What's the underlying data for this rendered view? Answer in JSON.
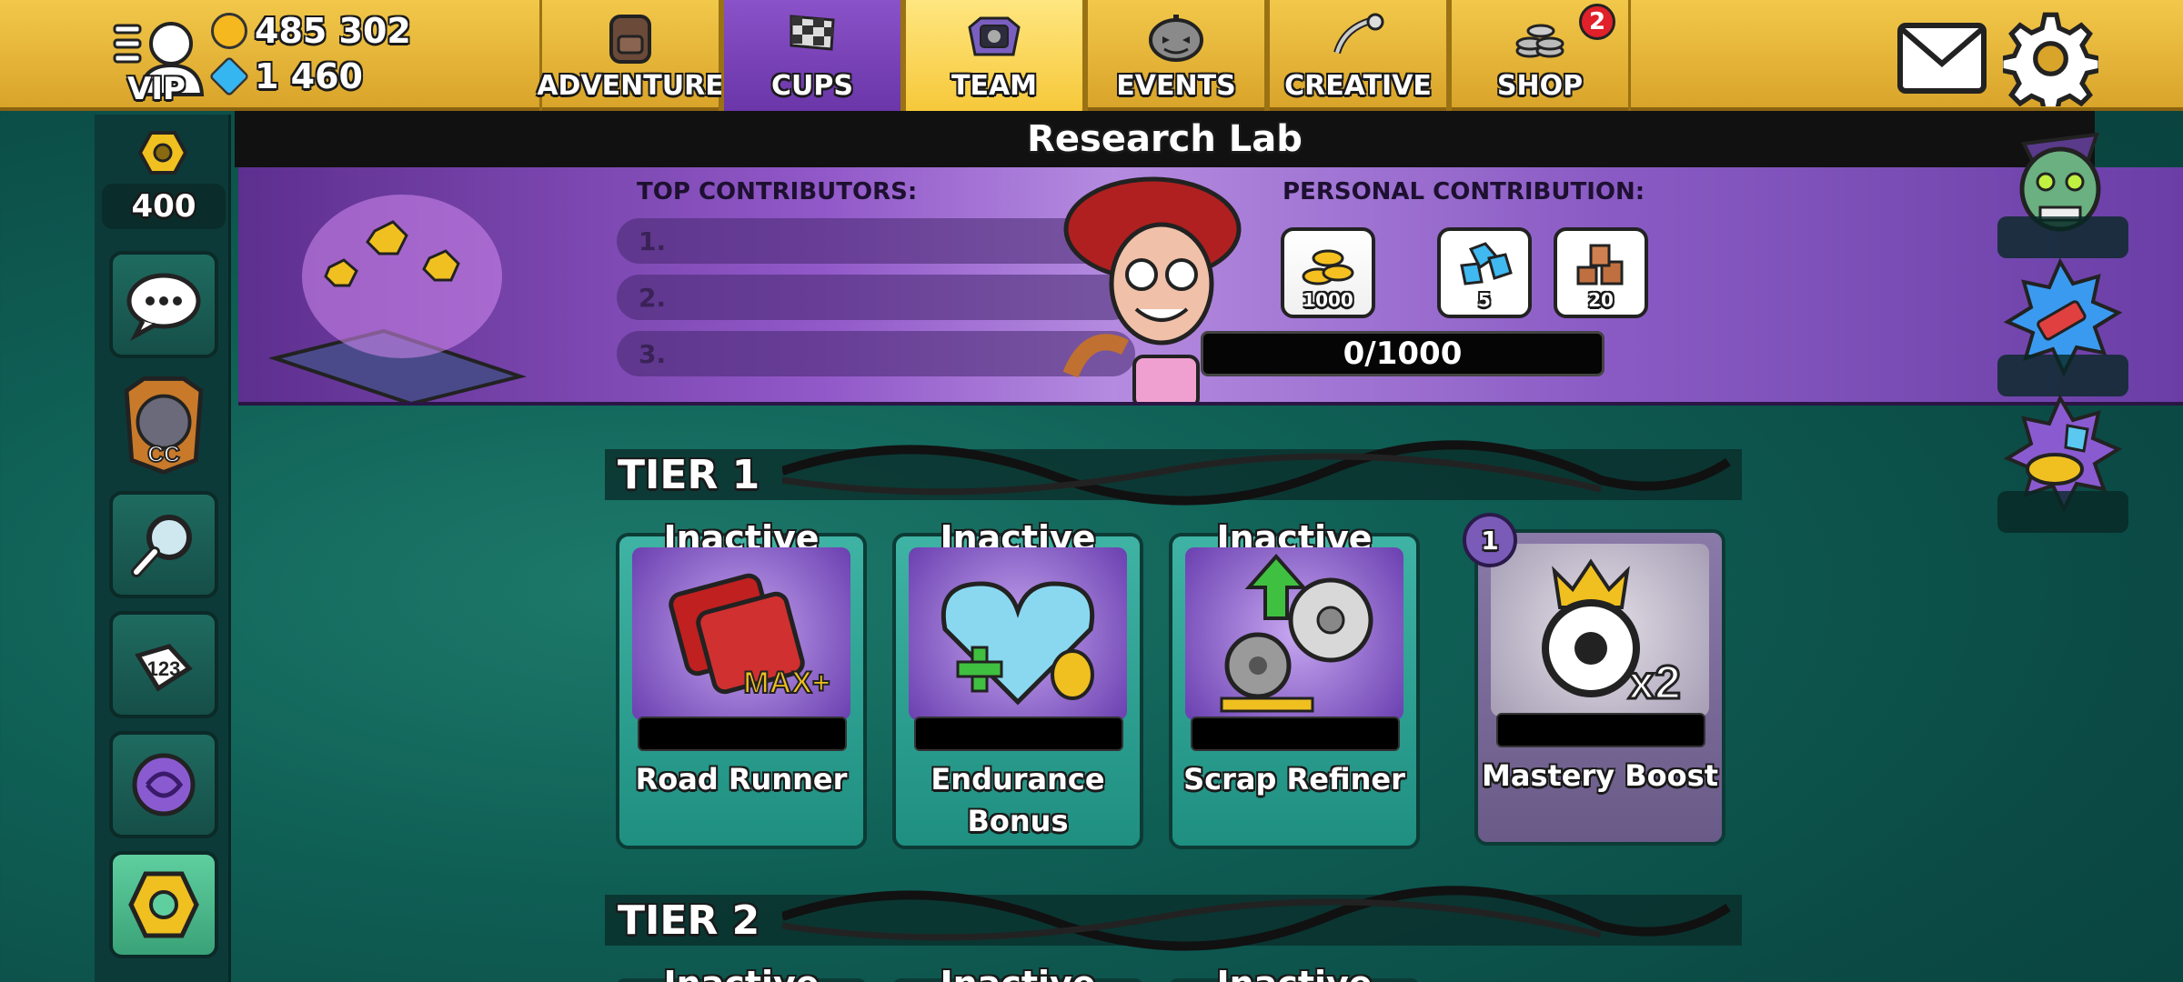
{
  "profile": {
    "vip_label": "VIP"
  },
  "currency": {
    "coins": "485 302",
    "gems": "1 460"
  },
  "tabs": [
    {
      "label": "ADVENTURE",
      "icon": "backpack-icon",
      "active": false
    },
    {
      "label": "CUPS",
      "icon": "checkered-flag-icon",
      "active": false
    },
    {
      "label": "TEAM",
      "icon": "team-emblem-icon",
      "active": true
    },
    {
      "label": "EVENTS",
      "icon": "pumpkin-icon",
      "active": false
    },
    {
      "label": "CREATIVE",
      "icon": "paint-brush-icon",
      "active": false
    },
    {
      "label": "SHOP",
      "icon": "coin-stack-icon",
      "active": false,
      "badge": "2"
    }
  ],
  "sidebar": {
    "scrap_count": "400"
  },
  "lab": {
    "title": "Research Lab",
    "top_contributors_label": "TOP CONTRIBUTORS:",
    "contributors": [
      "1.",
      "2.",
      "3."
    ],
    "personal_label": "PERSONAL CONTRIBUTION:",
    "rewards": [
      {
        "amount": "1000",
        "icon": "coins-icon"
      },
      {
        "amount": "5",
        "icon": "gems-icon"
      },
      {
        "amount": "20",
        "icon": "scrap-icon"
      }
    ],
    "progress_text": "0/1000",
    "progress_value": 0
  },
  "tiers": [
    {
      "label": "TIER 1",
      "cards": [
        {
          "status": "Inactive",
          "name": "Road Runner"
        },
        {
          "status": "Inactive",
          "name": "Endurance Bonus"
        },
        {
          "status": "Inactive",
          "name": "Scrap Refiner"
        },
        {
          "status": "",
          "name": "Mastery Boost",
          "level": "1"
        }
      ]
    },
    {
      "label": "TIER 2",
      "cards": [
        {
          "status": "Inactive"
        },
        {
          "status": "Inactive"
        },
        {
          "status": "Inactive"
        }
      ]
    }
  ],
  "colors": {
    "topbar": "#e8b83a",
    "tab_cups": "#7a46b8",
    "tab_team": "#ffd84a",
    "background": "#0f5f55",
    "badge_red": "#e0202a"
  }
}
